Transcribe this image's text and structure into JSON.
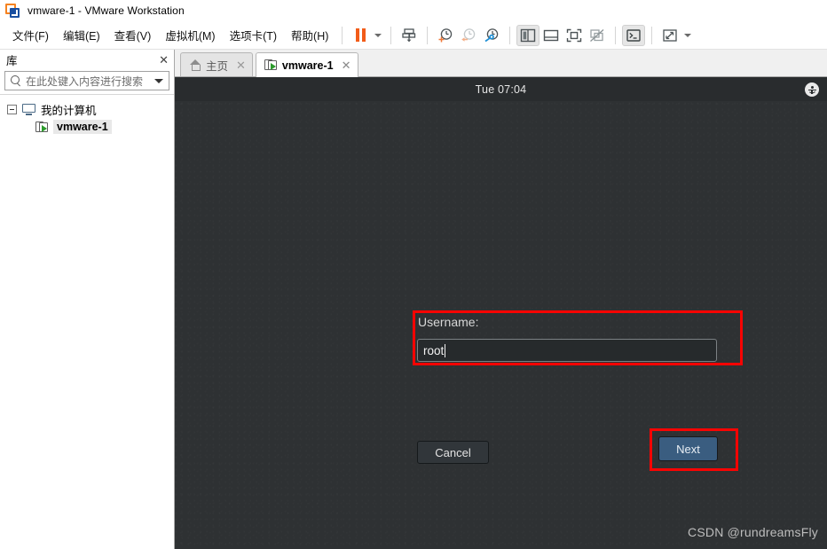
{
  "window": {
    "title": "vmware-1 - VMware Workstation",
    "app_icon": "vmware-logo-icon"
  },
  "menubar": {
    "items": [
      {
        "label": "文件(F)",
        "name": "menu-file"
      },
      {
        "label": "编辑(E)",
        "name": "menu-edit"
      },
      {
        "label": "查看(V)",
        "name": "menu-view"
      },
      {
        "label": "虚拟机(M)",
        "name": "menu-vm"
      },
      {
        "label": "选项卡(T)",
        "name": "menu-tabs"
      },
      {
        "label": "帮助(H)",
        "name": "menu-help"
      }
    ]
  },
  "toolbar": {
    "buttons": [
      {
        "name": "suspend-button",
        "icon": "pause-icon"
      },
      {
        "name": "power-dropdown",
        "icon": "chevron-down-icon"
      },
      {
        "name": "snapshot-button",
        "icon": "snapshot-icon"
      },
      {
        "name": "take-snapshot-button",
        "icon": "clock-plus-icon"
      },
      {
        "name": "revert-snapshot-button",
        "icon": "clock-back-icon"
      },
      {
        "name": "snapshot-manager-button",
        "icon": "clock-wrench-icon"
      },
      {
        "name": "show-library-button",
        "icon": "sidebar-panel-icon"
      },
      {
        "name": "show-thumbnails-button",
        "icon": "bottom-panel-icon"
      },
      {
        "name": "fullscreen-button",
        "icon": "fullscreen-icon"
      },
      {
        "name": "unity-button",
        "icon": "unity-icon"
      },
      {
        "name": "console-button",
        "icon": "terminal-icon"
      },
      {
        "name": "stretch-button",
        "icon": "expand-arrows-icon"
      },
      {
        "name": "stretch-dropdown",
        "icon": "chevron-down-icon"
      }
    ]
  },
  "sidebar": {
    "title": "库",
    "close_label": "✕",
    "search": {
      "placeholder": "在此处键入内容进行搜索",
      "value": ""
    },
    "tree": [
      {
        "label": "我的计算机",
        "name": "tree-item-my-computer",
        "icon": "computer-icon",
        "expanded": true
      },
      {
        "label": "vmware-1",
        "name": "tree-item-vmware-1",
        "icon": "vm-running-icon",
        "selected": true
      }
    ]
  },
  "tabs": [
    {
      "label": "主页",
      "name": "tab-home",
      "icon": "home-icon",
      "active": false,
      "close": "✕"
    },
    {
      "label": "vmware-1",
      "name": "tab-vmware-1",
      "icon": "vm-running-icon",
      "active": true,
      "close": "✕"
    }
  ],
  "vm_screen": {
    "topbar": {
      "clock": "Tue 07:04",
      "accessibility_icon": "accessibility-icon"
    },
    "login": {
      "username_label": "Username:",
      "username_value": "root",
      "username_placeholder": "",
      "cancel_label": "Cancel",
      "next_label": "Next"
    },
    "watermark": "CSDN @rundreamsFly"
  },
  "colors": {
    "annotation_red": "#f90403",
    "accent_orange": "#f25c19",
    "next_button_blue": "#3a5d80",
    "vm_background": "#2e3133",
    "vm_topbar": "#292c2e"
  }
}
